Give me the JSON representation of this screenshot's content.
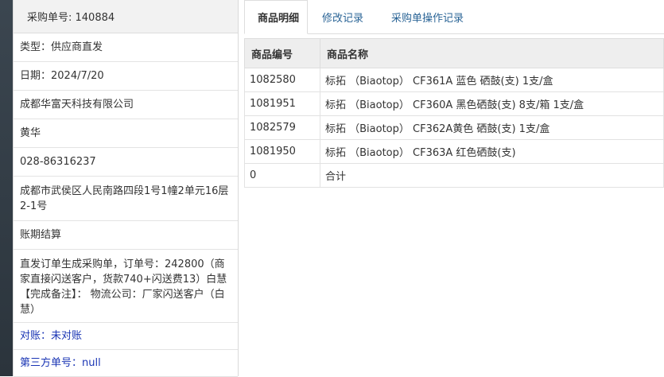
{
  "order": {
    "number_label": "采购单号: 140884"
  },
  "details": [
    {
      "text": "类型：供应商直发",
      "style": "normal"
    },
    {
      "text": "日期：2024/7/20",
      "style": "normal"
    },
    {
      "text": "成都华富天科技有限公司",
      "style": "normal"
    },
    {
      "text": "黄华",
      "style": "normal"
    },
    {
      "text": "028-86316237",
      "style": "normal"
    },
    {
      "text": "成都市武侯区人民南路四段1号1幢2单元16层2-1号",
      "style": "normal"
    },
    {
      "text": "账期结算",
      "style": "normal"
    },
    {
      "text": "直发订单生成采购单，订单号：242800（商家直接闪送客户，货款740+闪送费13）白慧【完成备注】： 物流公司：厂家闪送客户（白慧）",
      "style": "normal"
    },
    {
      "text": "对账：未对账",
      "style": "blue"
    },
    {
      "text": "第三方单号：null",
      "style": "blue"
    }
  ],
  "tabs": [
    {
      "label": "商品明细",
      "active": true
    },
    {
      "label": "修改记录",
      "active": false
    },
    {
      "label": "采购单操作记录",
      "active": false
    }
  ],
  "table": {
    "headers": [
      "商品编号",
      "商品名称"
    ],
    "rows": [
      [
        "1082580",
        "标拓 （Biaotop） CF361A 蓝色 硒鼓(支) 1支/盒"
      ],
      [
        "1081951",
        "标拓 （Biaotop） CF360A 黑色硒鼓(支) 8支/箱 1支/盒"
      ],
      [
        "1082579",
        "标拓 （Biaotop） CF362A黄色 硒鼓(支) 1支/盒"
      ],
      [
        "1081950",
        "标拓 （Biaotop） CF363A 红色硒鼓(支)"
      ],
      [
        "0",
        "合计"
      ]
    ]
  }
}
